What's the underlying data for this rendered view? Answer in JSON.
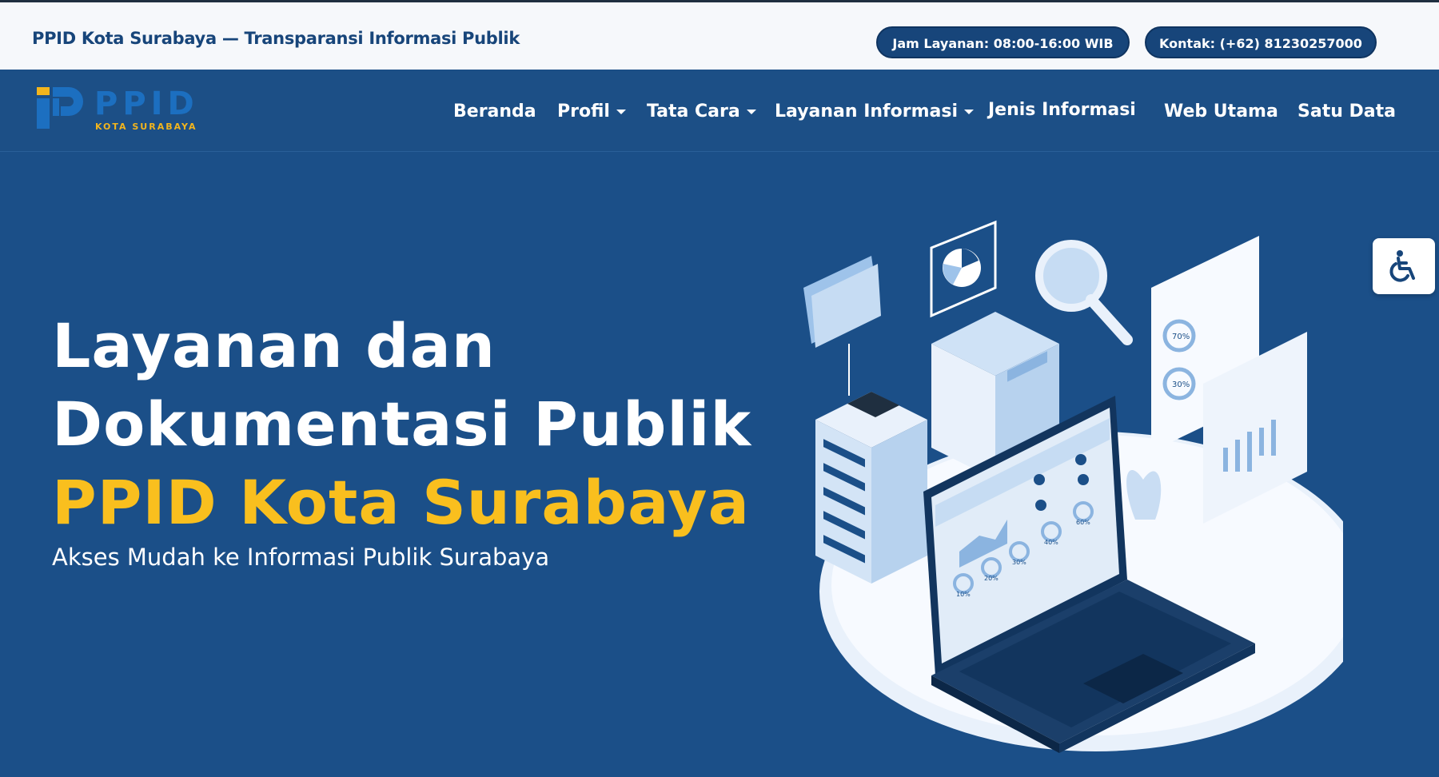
{
  "topbar": {
    "tagline": "PPID Kota Surabaya — Transparansi Informasi Publik",
    "hours": "Jam Layanan: 08:00-16:00 WIB",
    "contact": "Kontak: (+62) 81230257000"
  },
  "logo": {
    "name": "PPID",
    "city": "KOTA SURABAYA"
  },
  "nav": {
    "home": "Beranda",
    "profile": "Profil",
    "procedure": "Tata Cara",
    "services": "Layanan Informasi",
    "types": "Jenis Informasi",
    "main_web": "Web Utama",
    "one_data": "Satu Data"
  },
  "hero": {
    "line1": "Layanan dan",
    "line2": "Dokumentasi Publik",
    "line3": "PPID Kota Surabaya",
    "subtitle": "Akses Mudah ke Informasi Publik Surabaya"
  },
  "illustration": {
    "labels": [
      "70%",
      "30%",
      "10%",
      "20%",
      "30%",
      "40%",
      "60%"
    ]
  },
  "colors": {
    "navy": "#1b4f88",
    "accent_yellow": "#f9bf1e",
    "dark_blue": "#17457a"
  },
  "icons": {
    "accessibility": "wheelchair-icon",
    "dropdown": "caret-down-icon"
  }
}
